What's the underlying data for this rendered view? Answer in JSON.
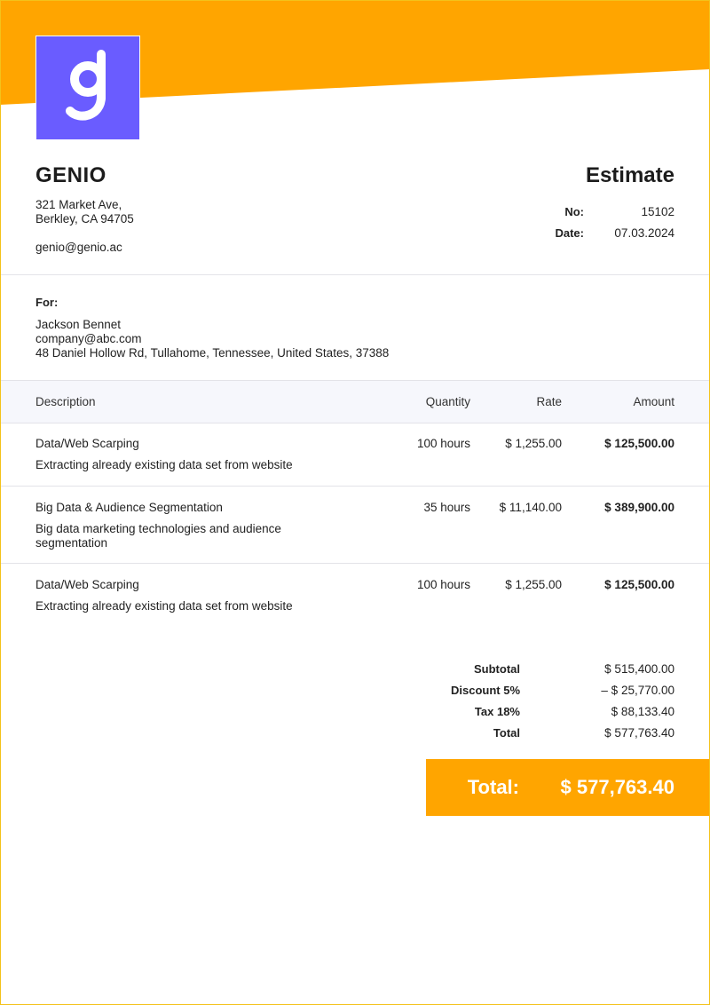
{
  "company": {
    "name": "GENIO",
    "address_line1": "321 Market Ave,",
    "address_line2": "Berkley, CA 94705",
    "email": "genio@genio.ac"
  },
  "document": {
    "title": "Estimate",
    "no_label": "No:",
    "no_value": "15102",
    "date_label": "Date:",
    "date_value": "07.03.2024"
  },
  "client": {
    "for_label": "For:",
    "name": "Jackson Bennet",
    "email": "company@abc.com",
    "address": "48 Daniel Hollow Rd, Tullahome, Tennessee, United States, 37388"
  },
  "table": {
    "headers": {
      "description": "Description",
      "quantity": "Quantity",
      "rate": "Rate",
      "amount": "Amount"
    },
    "rows": [
      {
        "description": "Data/Web Scarping",
        "details": "Extracting already existing data set from website",
        "quantity": "100 hours",
        "rate": "$ 1,255.00",
        "amount": "$ 125,500.00"
      },
      {
        "description": "Big Data & Audience Segmentation",
        "details": "Big data marketing technologies and audience segmentation",
        "quantity": "35 hours",
        "rate": "$ 11,140.00",
        "amount": "$ 389,900.00"
      },
      {
        "description": "Data/Web Scarping",
        "details": "Extracting already existing data set from website",
        "quantity": "100 hours",
        "rate": "$ 1,255.00",
        "amount": "$ 125,500.00"
      }
    ]
  },
  "totals": {
    "subtotal_label": "Subtotal",
    "subtotal_value": "$ 515,400.00",
    "discount_label": "Discount 5%",
    "discount_value": "– $ 25,770.00",
    "tax_label": "Tax 18%",
    "tax_value": "$ 88,133.40",
    "total_label": "Total",
    "total_value": "$ 577,763.40",
    "grand_label": "Total:",
    "grand_value": "$ 577,763.40"
  },
  "colors": {
    "accent": "#ffa500",
    "logo_bg": "#6a5cff",
    "table_head_bg": "#f6f7fc"
  },
  "icons": {
    "logo": "genio-g-logo"
  }
}
